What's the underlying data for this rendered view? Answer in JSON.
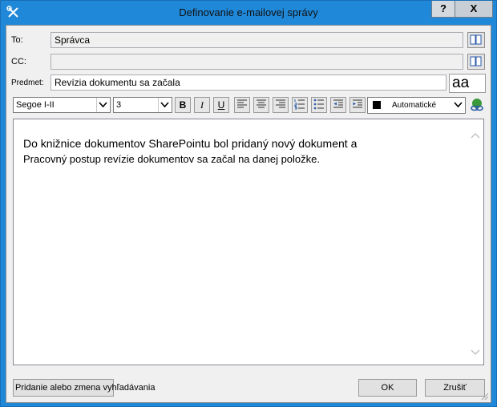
{
  "window": {
    "title": "Definovanie e-mailovej správy",
    "help_label": "?",
    "close_label": "X"
  },
  "fields": {
    "to_label": "To:",
    "to_value": "Správca",
    "cc_label": "CC:",
    "cc_value": "",
    "subject_label": "Predmet:",
    "subject_value": "Revízia dokumentu sa začala"
  },
  "format": {
    "aa_label": "aa",
    "font": "Segoe I-II",
    "size": "3",
    "bold": "B",
    "italic": "I",
    "underline": "U",
    "color_value": "Automatické",
    "color_swatch": "#000000"
  },
  "body": {
    "line1": "Do knižnice dokumentov SharePointu bol pridaný nový dokument a",
    "line2": "Pracovný postup revízie dokumentov sa začal na danej položke."
  },
  "buttons": {
    "lookup": "Pridanie alebo zmena vyhľadávania",
    "ok": "OK",
    "cancel": "Zrušiť"
  },
  "icons": [
    "app-tools-icon",
    "address-book-icon",
    "align-left-icon",
    "align-center-icon",
    "align-right-icon",
    "numbered-list-icon",
    "bulleted-list-icon",
    "decrease-indent-icon",
    "increase-indent-icon",
    "hyperlink-icon"
  ],
  "colors": {
    "titlebar": "#1f88d9",
    "dialog_bg": "#f0f0f0"
  }
}
